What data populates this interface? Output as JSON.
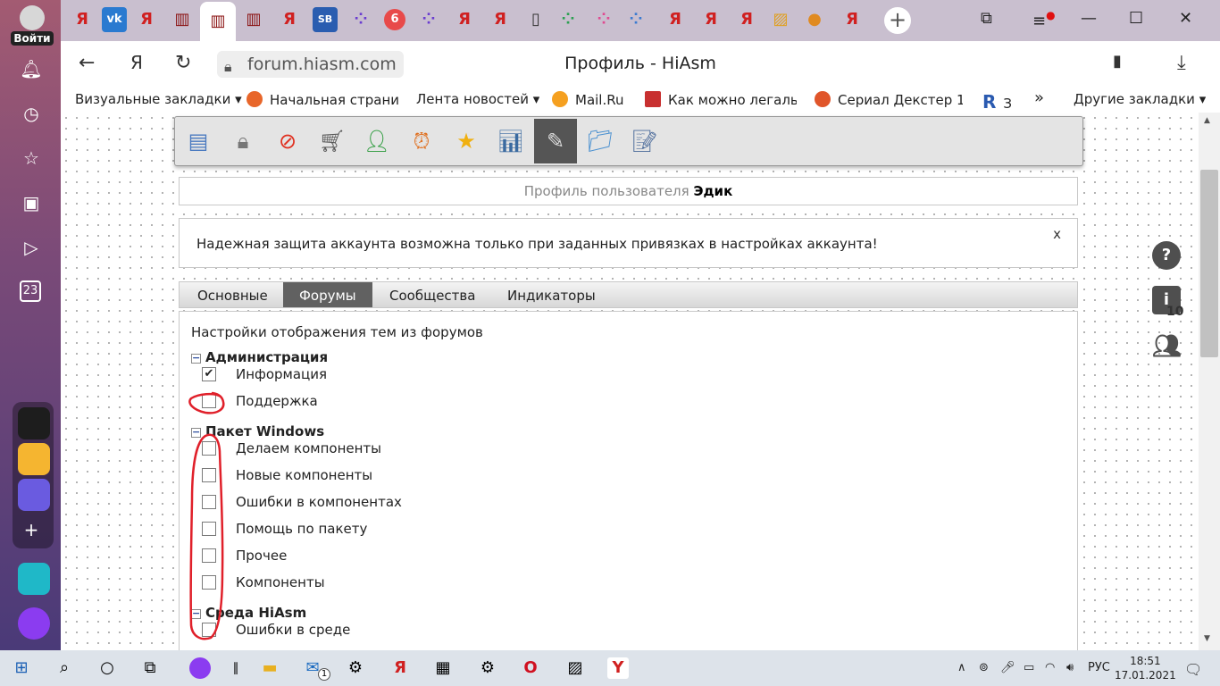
{
  "sidebar": {
    "login_label": "Войти",
    "counter_badge": "23"
  },
  "tabs": {
    "badge_count": "6"
  },
  "address_bar": {
    "yandex_glyph": "Я",
    "url": "forum.hiasm.com",
    "page_title": "Профиль - HiAsm"
  },
  "bookmarks": {
    "items": [
      {
        "label": "Визуальные закладки",
        "dropdown": true
      },
      {
        "label": "Начальная страни"
      },
      {
        "label": "Лента новостей",
        "dropdown": true
      },
      {
        "label": "Mail.Ru"
      },
      {
        "label": "Как можно легаль"
      },
      {
        "label": "Сериал Декстер 1"
      },
      {
        "label": "З"
      }
    ],
    "more_label": "»",
    "other_label": "Другие закладки"
  },
  "toolbar": {
    "icons": [
      "profile-card-icon",
      "lock-icon",
      "block-icon",
      "cart-icon",
      "user-icon",
      "alarm-clock-icon",
      "star-icon",
      "chart-icon",
      "tools-icon",
      "folder-icon",
      "notepad-icon"
    ],
    "active_index": 8
  },
  "profile": {
    "header_prefix": "Профиль пользователя",
    "username": "Эдик",
    "notice": "Надежная защита аккаунта возможна только при заданных привязках в настройках аккаунта!",
    "notice_close": "x"
  },
  "profile_tabs": [
    {
      "label": "Основные"
    },
    {
      "label": "Форумы",
      "active": true
    },
    {
      "label": "Сообщества"
    },
    {
      "label": "Индикаторы"
    }
  ],
  "forums": {
    "title": "Настройки отображения тем из форумов",
    "groups": [
      {
        "name": "Администрация",
        "items": [
          {
            "label": "Информация",
            "checked": true
          },
          {
            "label": "Поддержка",
            "checked": false
          }
        ]
      },
      {
        "name": "Пакет Windows",
        "items": [
          {
            "label": "Делаем компоненты",
            "checked": false
          },
          {
            "label": "Новые компоненты",
            "checked": false
          },
          {
            "label": "Ошибки в компонентах",
            "checked": false
          },
          {
            "label": "Помощь по пакету",
            "checked": false
          },
          {
            "label": "Прочее",
            "checked": false
          },
          {
            "label": "Компоненты",
            "checked": false
          }
        ]
      },
      {
        "name": "Среда HiAsm",
        "items": [
          {
            "label": "Ошибки в среде",
            "checked": false
          }
        ]
      }
    ]
  },
  "side_widgets": {
    "help_glyph": "?",
    "info_glyph": "i",
    "info_count": "10"
  },
  "taskbar": {
    "mail_badge": "1",
    "lang": "РУС",
    "time": "18:51",
    "date": "17.01.2021"
  },
  "colors": {
    "annotation": "#e0202a",
    "active_tab": "#616161"
  }
}
